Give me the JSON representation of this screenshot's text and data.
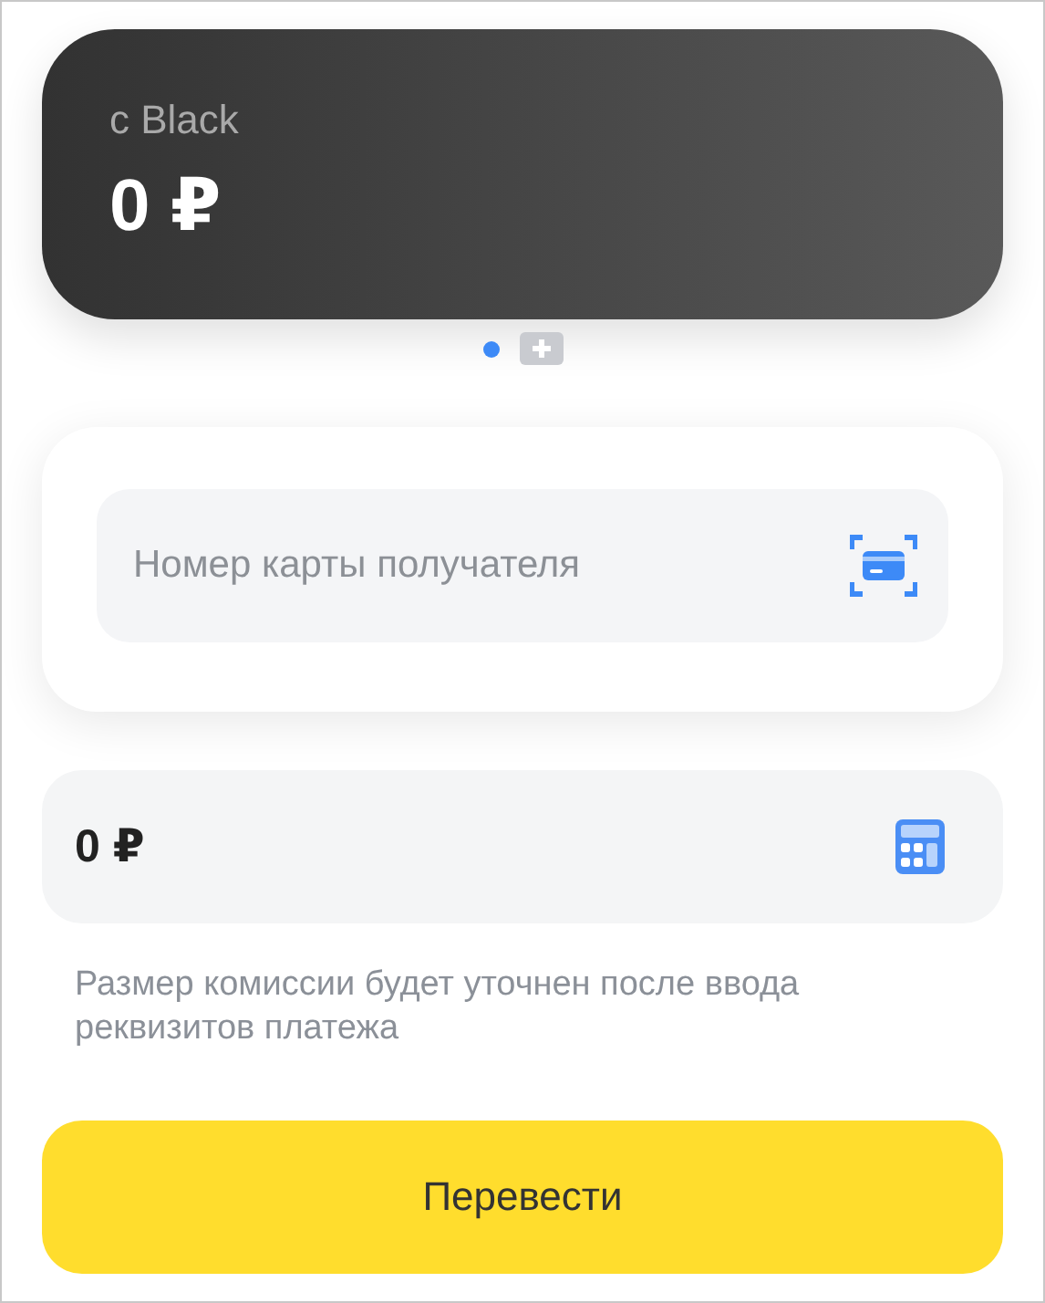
{
  "account_card": {
    "label": "с Black",
    "balance": "0 ₽"
  },
  "pager_dots": [
    {
      "selected": true
    }
  ],
  "recipient_card": {
    "placeholder": "Номер карты получателя"
  },
  "amount": {
    "value": "0 ₽"
  },
  "commission_note": "Размер комиссии будет уточнен после ввода реквизитов платежа",
  "submit_button": "Перевести"
}
